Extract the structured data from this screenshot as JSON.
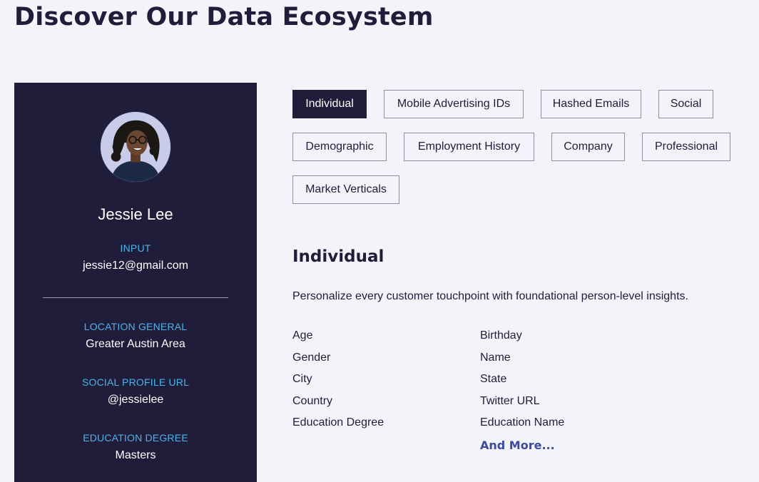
{
  "page_title": "Discover Our Data Ecosystem",
  "profile": {
    "name": "Jessie Lee",
    "fields": [
      {
        "label": "INPUT",
        "value": "jessie12@gmail.com"
      },
      {
        "label": "LOCATION GENERAL",
        "value": "Greater Austin Area"
      },
      {
        "label": "SOCIAL PROFILE URL",
        "value": "@jessielee"
      },
      {
        "label": "EDUCATION DEGREE",
        "value": "Masters"
      }
    ]
  },
  "tabs": [
    {
      "label": "Individual",
      "active": true
    },
    {
      "label": "Mobile Advertising IDs",
      "active": false
    },
    {
      "label": "Hashed Emails",
      "active": false
    },
    {
      "label": "Social",
      "active": false
    },
    {
      "label": "Demographic",
      "active": false
    },
    {
      "label": "Employment History",
      "active": false
    },
    {
      "label": "Company",
      "active": false
    },
    {
      "label": "Professional",
      "active": false
    },
    {
      "label": "Market Verticals",
      "active": false
    }
  ],
  "section": {
    "title": "Individual",
    "description": "Personalize every customer touchpoint with foundational person-level insights.",
    "attributes_left": [
      "Age",
      "Gender",
      "City",
      "Country",
      "Education Degree"
    ],
    "attributes_right": [
      "Birthday",
      "Name",
      "State",
      "Twitter URL",
      "Education Name"
    ],
    "more_label": "And More..."
  },
  "colors": {
    "background": "#f3f4fa",
    "card": "#1f1d3a",
    "label_accent": "#4fb2e8",
    "link": "#3a4aa0"
  }
}
